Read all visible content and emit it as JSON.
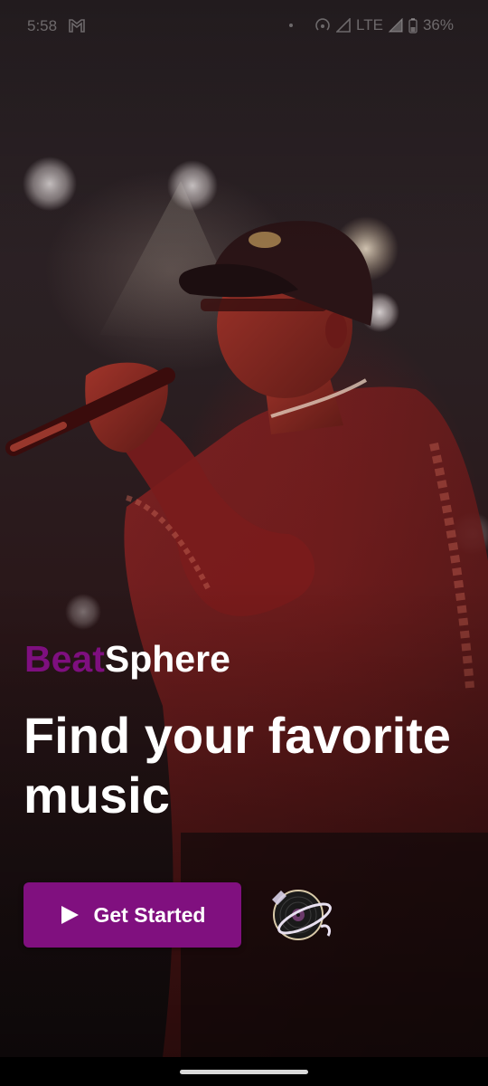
{
  "status_bar": {
    "time": "5:58",
    "network": "LTE",
    "battery": "36%",
    "icons": [
      "gmail-icon",
      "hotspot-icon",
      "signal-icon",
      "battery-icon"
    ]
  },
  "brand": {
    "part1": "Beat",
    "part2": "Sphere",
    "accent_color": "#7e0f7f"
  },
  "headline": "Find your favorite music",
  "cta": {
    "label": "Get Started",
    "icon": "play-icon",
    "color": "#80107f"
  },
  "logo_icon": "vinyl-record-icon",
  "background_image": "concert singer with microphone"
}
